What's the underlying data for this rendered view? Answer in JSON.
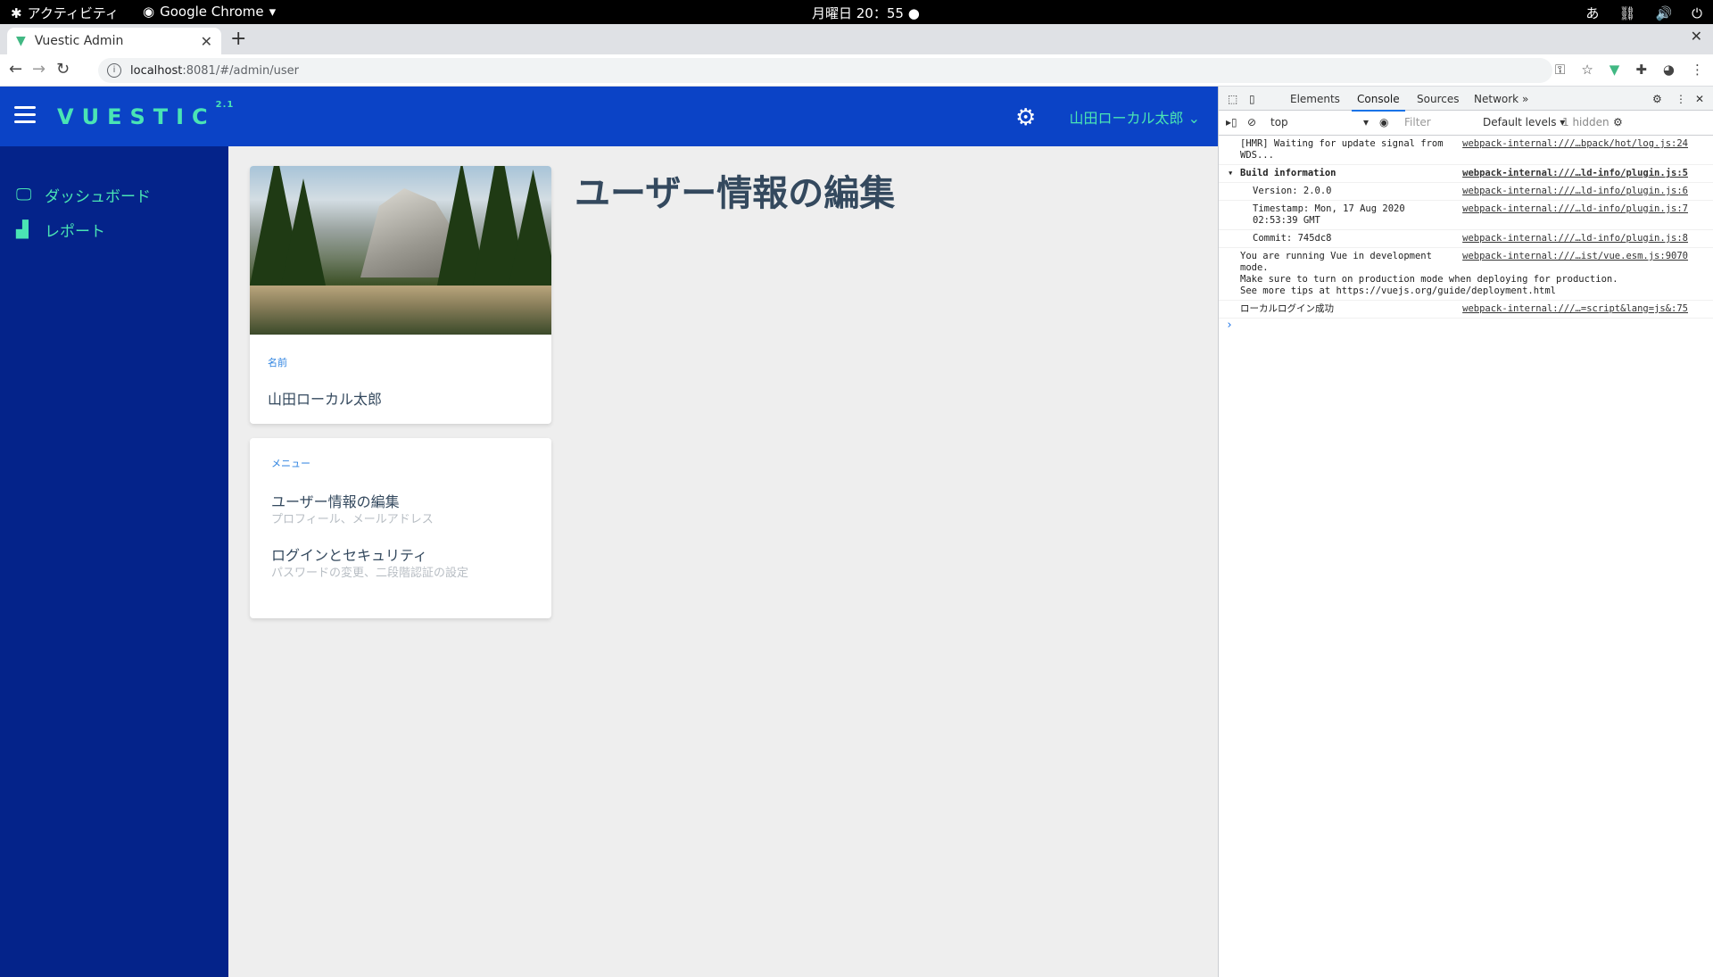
{
  "os": {
    "activities": "アクティビティ",
    "app_name": "Google Chrome",
    "clock": "月曜日 20：55",
    "ime": "あ"
  },
  "browser": {
    "tab_title": "Vuestic Admin",
    "url_host": "localhost",
    "url_path": ":8081/#/admin/user"
  },
  "app": {
    "logo": "VUESTIC",
    "version": "2.1",
    "user_name": "山田ローカル太郎",
    "sidebar": [
      {
        "label": "ダッシュボード",
        "icon": "monitor-icon"
      },
      {
        "label": "レポート",
        "icon": "bar-chart-icon"
      }
    ],
    "profile_card": {
      "name_label": "名前",
      "name_value": "山田ローカル太郎"
    },
    "menu_card": {
      "label": "メニュー",
      "items": [
        {
          "title": "ユーザー情報の編集",
          "sub": "プロフィール、メールアドレス"
        },
        {
          "title": "ログインとセキュリティ",
          "sub": "パスワードの変更、二段階認証の設定"
        }
      ]
    },
    "heading": "ユーザー情報の編集"
  },
  "devtools": {
    "tabs": [
      "Elements",
      "Console",
      "Sources",
      "Network"
    ],
    "active_tab": "Console",
    "context": "top",
    "filter_placeholder": "Filter",
    "levels": "Default levels ▾",
    "hidden": "1 hidden",
    "logs": [
      {
        "msg": "[HMR] Waiting for update signal from WDS...",
        "src": "webpack-internal:///…bpack/hot/log.js:24"
      },
      {
        "msg": "Build information",
        "src": "webpack-internal:///…ld-info/plugin.js:5"
      },
      {
        "msg": "Version: 2.0.0",
        "src": "webpack-internal:///…ld-info/plugin.js:6"
      },
      {
        "msg": "Timestamp: Mon, 17 Aug 2020 02:53:39 GMT",
        "src": "webpack-internal:///…ld-info/plugin.js:7"
      },
      {
        "msg": "Commit: 745dc8",
        "src": "webpack-internal:///…ld-info/plugin.js:8"
      },
      {
        "msg": "You are running Vue in development mode.",
        "src": "webpack-internal:///…ist/vue.esm.js:9070"
      },
      {
        "msg": "Make sure to turn on production mode when deploying for production.",
        "src": ""
      },
      {
        "msg": "See more tips at https://vuejs.org/guide/deployment.html",
        "src": ""
      },
      {
        "msg": "ローカルログイン成功",
        "src": "webpack-internal:///…=script&lang=js&:75"
      }
    ]
  }
}
